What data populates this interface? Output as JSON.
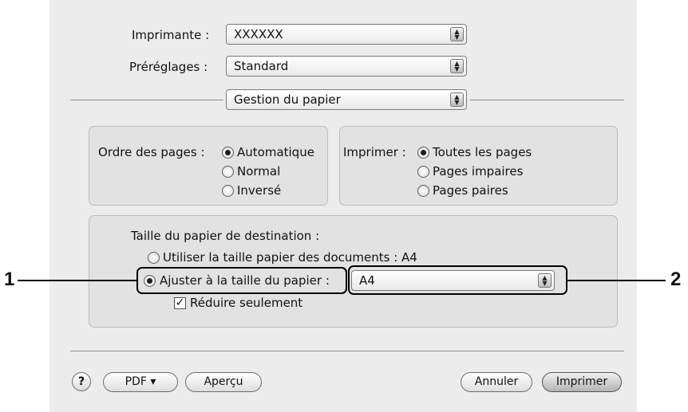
{
  "printer": {
    "label": "Imprimante :",
    "value": "XXXXXX"
  },
  "presets": {
    "label": "Préréglages :",
    "value": "Standard"
  },
  "panel": {
    "value": "Gestion du papier"
  },
  "page_order": {
    "label": "Ordre des pages :",
    "options": [
      "Automatique",
      "Normal",
      "Inversé"
    ],
    "selected": "Automatique"
  },
  "print_range": {
    "label": "Imprimer :",
    "options": [
      "Toutes les pages",
      "Pages impaires",
      "Pages paires"
    ],
    "selected": "Toutes les pages"
  },
  "destination": {
    "heading": "Taille du papier de destination :",
    "use_document_size": "Utiliser la taille papier des documents : A4",
    "fit_to_paper": "Ajuster à la taille du papier :",
    "paper_size_value": "A4",
    "reduce_only": "Réduire seulement",
    "reduce_only_checked": true,
    "selected": "fit_to_paper"
  },
  "footer": {
    "help": "?",
    "pdf": "PDF ▾",
    "preview": "Aperçu",
    "cancel": "Annuler",
    "print": "Imprimer"
  },
  "callouts": [
    "1",
    "2"
  ]
}
